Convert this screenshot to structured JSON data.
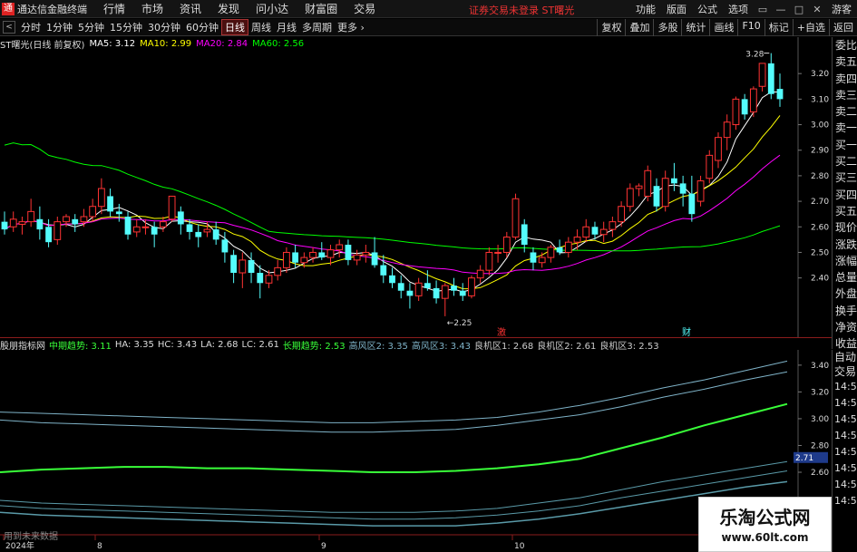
{
  "app": {
    "logo": "通",
    "title": "通达信金融终端",
    "menu": [
      "行情",
      "市场",
      "资讯",
      "发现",
      "问小达",
      "财富圈",
      "交易"
    ],
    "login_status": "证券交易未登录  ST曙光",
    "right_menu": [
      "功能",
      "版面",
      "公式",
      "选项"
    ],
    "guest": "游客",
    "window_buttons": [
      "▭",
      "—",
      "□",
      "✕"
    ]
  },
  "toolbar": {
    "back": "<",
    "periods": [
      "分时",
      "1分钟",
      "5分钟",
      "15分钟",
      "30分钟",
      "60分钟",
      "日线",
      "周线",
      "月线",
      "多周期",
      "更多 ›"
    ],
    "active_period": "日线",
    "right_buttons": [
      "复权",
      "叠加",
      "多股",
      "统计",
      "画线",
      "F10",
      "标记",
      "+自选",
      "返回"
    ]
  },
  "quote": {
    "stock": "ST曙光(日线 前复权)",
    "ma5": "MA5: 3.12",
    "ma10": "MA10: 2.99",
    "ma20": "MA20: 2.84",
    "ma60": "MA60: 2.56"
  },
  "indicator": {
    "name": "股朋指标网",
    "mid_trend": "中期趋势: 3.11",
    "ha": "HA: 3.35",
    "hc": "HC: 3.43",
    "la": "LA: 2.68",
    "lc": "LC: 2.61",
    "long_trend": "长期趋势: 2.53",
    "risk1": "高风区2: 3.35",
    "risk2": "高风区3: 3.43",
    "chance1": "良机区1: 2.68",
    "chance2": "良机区2: 2.61",
    "chance3": "良机区3: 2.53"
  },
  "colors": {
    "up": "#ff3333",
    "down": "#54fcfc",
    "ma5": "#ffffff",
    "ma10": "#ffff00",
    "ma20": "#ff00ff",
    "ma60": "#00ff00",
    "mid_trend": "#39ff39",
    "risk": "#7fb3c8",
    "chance": "#5a9aa8"
  },
  "sidebar": [
    "委比",
    "卖五",
    "卖四",
    "卖三",
    "卖二",
    "卖一",
    "买一",
    "买二",
    "买三",
    "买四",
    "买五",
    "现价",
    "涨跌",
    "涨幅",
    "总量",
    "外盘",
    "换手",
    "净资",
    "收益"
  ],
  "sidebar2": {
    "labels": [
      "自动",
      "交易"
    ],
    "times": [
      "14:56",
      "14:56",
      "14:56",
      "14:56",
      "14:56",
      "14:56",
      "14:56",
      "14:56"
    ]
  },
  "annotations": {
    "high": "3.28",
    "low": "2.25",
    "tag1": "激",
    "tag2": "财",
    "current": "2.71"
  },
  "x_labels": [
    "2024年",
    "8",
    "9",
    "10"
  ],
  "future_text": "用到未来数据",
  "watermark": {
    "title": "乐淘公式网",
    "url": "www.60lt.com"
  },
  "chart_data": [
    {
      "type": "candlestick",
      "title": "ST曙光(日线 前复权)",
      "y_ticks": [
        3.2,
        3.1,
        3.0,
        2.9,
        2.8,
        2.7,
        2.6,
        2.5,
        2.4
      ],
      "ylim": [
        2.2,
        3.3
      ],
      "x_labels": [
        "2024年",
        "8",
        "9",
        "10"
      ],
      "ohlc": [
        [
          2.62,
          2.66,
          2.57,
          2.59
        ],
        [
          2.6,
          2.66,
          2.58,
          2.63
        ],
        [
          2.61,
          2.64,
          2.57,
          2.62
        ],
        [
          2.62,
          2.71,
          2.6,
          2.66
        ],
        [
          2.63,
          2.68,
          2.55,
          2.59
        ],
        [
          2.6,
          2.63,
          2.52,
          2.54
        ],
        [
          2.55,
          2.64,
          2.53,
          2.62
        ],
        [
          2.62,
          2.65,
          2.6,
          2.64
        ],
        [
          2.63,
          2.65,
          2.58,
          2.61
        ],
        [
          2.62,
          2.67,
          2.6,
          2.64
        ],
        [
          2.64,
          2.71,
          2.62,
          2.68
        ],
        [
          2.68,
          2.79,
          2.65,
          2.75
        ],
        [
          2.72,
          2.75,
          2.64,
          2.66
        ],
        [
          2.66,
          2.69,
          2.62,
          2.65
        ],
        [
          2.64,
          2.66,
          2.55,
          2.57
        ],
        [
          2.58,
          2.63,
          2.56,
          2.6
        ],
        [
          2.6,
          2.63,
          2.57,
          2.6
        ],
        [
          2.6,
          2.62,
          2.52,
          2.57
        ],
        [
          2.6,
          2.64,
          2.58,
          2.62
        ],
        [
          2.63,
          2.72,
          2.62,
          2.72
        ],
        [
          2.66,
          2.68,
          2.57,
          2.61
        ],
        [
          2.61,
          2.63,
          2.55,
          2.58
        ],
        [
          2.58,
          2.61,
          2.52,
          2.56
        ],
        [
          2.58,
          2.62,
          2.56,
          2.59
        ],
        [
          2.59,
          2.62,
          2.53,
          2.55
        ],
        [
          2.55,
          2.58,
          2.46,
          2.5
        ],
        [
          2.49,
          2.51,
          2.38,
          2.42
        ],
        [
          2.42,
          2.5,
          2.36,
          2.47
        ],
        [
          2.47,
          2.5,
          2.38,
          2.42
        ],
        [
          2.42,
          2.45,
          2.32,
          2.38
        ],
        [
          2.38,
          2.43,
          2.36,
          2.41
        ],
        [
          2.41,
          2.47,
          2.39,
          2.44
        ],
        [
          2.44,
          2.52,
          2.42,
          2.5
        ],
        [
          2.5,
          2.53,
          2.44,
          2.46
        ],
        [
          2.46,
          2.5,
          2.44,
          2.48
        ],
        [
          2.48,
          2.52,
          2.46,
          2.5
        ],
        [
          2.5,
          2.54,
          2.47,
          2.48
        ],
        [
          2.48,
          2.53,
          2.45,
          2.51
        ],
        [
          2.51,
          2.55,
          2.48,
          2.53
        ],
        [
          2.53,
          2.55,
          2.45,
          2.47
        ],
        [
          2.47,
          2.51,
          2.45,
          2.49
        ],
        [
          2.49,
          2.53,
          2.46,
          2.5
        ],
        [
          2.5,
          2.56,
          2.44,
          2.45
        ],
        [
          2.45,
          2.49,
          2.38,
          2.41
        ],
        [
          2.41,
          2.44,
          2.36,
          2.38
        ],
        [
          2.38,
          2.41,
          2.32,
          2.35
        ],
        [
          2.35,
          2.38,
          2.28,
          2.33
        ],
        [
          2.33,
          2.4,
          2.31,
          2.38
        ],
        [
          2.38,
          2.43,
          2.35,
          2.36
        ],
        [
          2.36,
          2.39,
          2.3,
          2.32
        ],
        [
          2.32,
          2.38,
          2.25,
          2.37
        ],
        [
          2.37,
          2.4,
          2.33,
          2.35
        ],
        [
          2.35,
          2.38,
          2.31,
          2.33
        ],
        [
          2.33,
          2.41,
          2.32,
          2.4
        ],
        [
          2.4,
          2.45,
          2.38,
          2.43
        ],
        [
          2.43,
          2.52,
          2.41,
          2.5
        ],
        [
          2.5,
          2.53,
          2.46,
          2.5
        ],
        [
          2.5,
          2.58,
          2.48,
          2.56
        ],
        [
          2.56,
          2.73,
          2.55,
          2.71
        ],
        [
          2.61,
          2.63,
          2.5,
          2.53
        ],
        [
          2.5,
          2.52,
          2.43,
          2.46
        ],
        [
          2.46,
          2.5,
          2.44,
          2.48
        ],
        [
          2.48,
          2.53,
          2.46,
          2.52
        ],
        [
          2.52,
          2.55,
          2.49,
          2.5
        ],
        [
          2.5,
          2.56,
          2.48,
          2.54
        ],
        [
          2.54,
          2.59,
          2.51,
          2.56
        ],
        [
          2.56,
          2.63,
          2.54,
          2.6
        ],
        [
          2.6,
          2.62,
          2.55,
          2.57
        ],
        [
          2.57,
          2.62,
          2.54,
          2.59
        ],
        [
          2.59,
          2.64,
          2.56,
          2.62
        ],
        [
          2.62,
          2.7,
          2.6,
          2.68
        ],
        [
          2.68,
          2.77,
          2.66,
          2.75
        ],
        [
          2.75,
          2.77,
          2.72,
          2.76
        ],
        [
          2.72,
          2.84,
          2.7,
          2.82
        ],
        [
          2.76,
          2.79,
          2.66,
          2.68
        ],
        [
          2.68,
          2.82,
          2.66,
          2.79
        ],
        [
          2.79,
          2.85,
          2.74,
          2.77
        ],
        [
          2.77,
          2.8,
          2.68,
          2.73
        ],
        [
          2.73,
          2.8,
          2.62,
          2.65
        ],
        [
          2.7,
          2.8,
          2.68,
          2.78
        ],
        [
          2.79,
          2.9,
          2.77,
          2.88
        ],
        [
          2.86,
          2.97,
          2.83,
          2.95
        ],
        [
          2.95,
          3.04,
          2.9,
          3.01
        ],
        [
          3.0,
          3.11,
          2.98,
          3.1
        ],
        [
          3.1,
          3.12,
          3.02,
          3.04
        ],
        [
          3.05,
          3.15,
          3.03,
          3.14
        ],
        [
          3.15,
          3.24,
          3.13,
          3.24
        ],
        [
          3.24,
          3.28,
          3.1,
          3.12
        ],
        [
          3.14,
          3.2,
          3.07,
          3.1
        ]
      ]
    },
    {
      "type": "line",
      "title": "股朋指标网",
      "y_ticks": [
        3.4,
        3.2,
        3.0,
        2.8,
        2.6
      ],
      "series": [
        {
          "name": "中期趋势",
          "values": [
            2.6,
            2.62,
            2.63,
            2.64,
            2.64,
            2.63,
            2.63,
            2.62,
            2.61,
            2.6,
            2.6,
            2.61,
            2.63,
            2.66,
            2.7,
            2.78,
            2.86,
            2.95,
            3.03,
            3.11
          ]
        },
        {
          "name": "高风区2",
          "values": [
            2.99,
            2.97,
            2.96,
            2.95,
            2.94,
            2.93,
            2.92,
            2.91,
            2.9,
            2.9,
            2.91,
            2.92,
            2.95,
            2.99,
            3.03,
            3.09,
            3.16,
            3.22,
            3.29,
            3.35
          ]
        },
        {
          "name": "高风区3",
          "values": [
            3.05,
            3.04,
            3.03,
            3.02,
            3.01,
            3.0,
            2.99,
            2.98,
            2.97,
            2.97,
            2.98,
            2.99,
            3.01,
            3.05,
            3.1,
            3.16,
            3.23,
            3.29,
            3.36,
            3.43
          ]
        },
        {
          "name": "良机区1",
          "values": [
            2.39,
            2.37,
            2.36,
            2.35,
            2.34,
            2.33,
            2.32,
            2.31,
            2.3,
            2.3,
            2.3,
            2.31,
            2.33,
            2.37,
            2.41,
            2.47,
            2.53,
            2.58,
            2.63,
            2.68
          ]
        },
        {
          "name": "良机区2",
          "values": [
            2.35,
            2.33,
            2.32,
            2.31,
            2.3,
            2.29,
            2.28,
            2.27,
            2.26,
            2.25,
            2.25,
            2.26,
            2.28,
            2.31,
            2.35,
            2.41,
            2.46,
            2.51,
            2.56,
            2.61
          ]
        },
        {
          "name": "良机区3",
          "values": [
            2.3,
            2.28,
            2.27,
            2.26,
            2.25,
            2.24,
            2.23,
            2.22,
            2.21,
            2.2,
            2.2,
            2.2,
            2.22,
            2.25,
            2.29,
            2.34,
            2.39,
            2.44,
            2.49,
            2.53
          ]
        }
      ]
    }
  ]
}
